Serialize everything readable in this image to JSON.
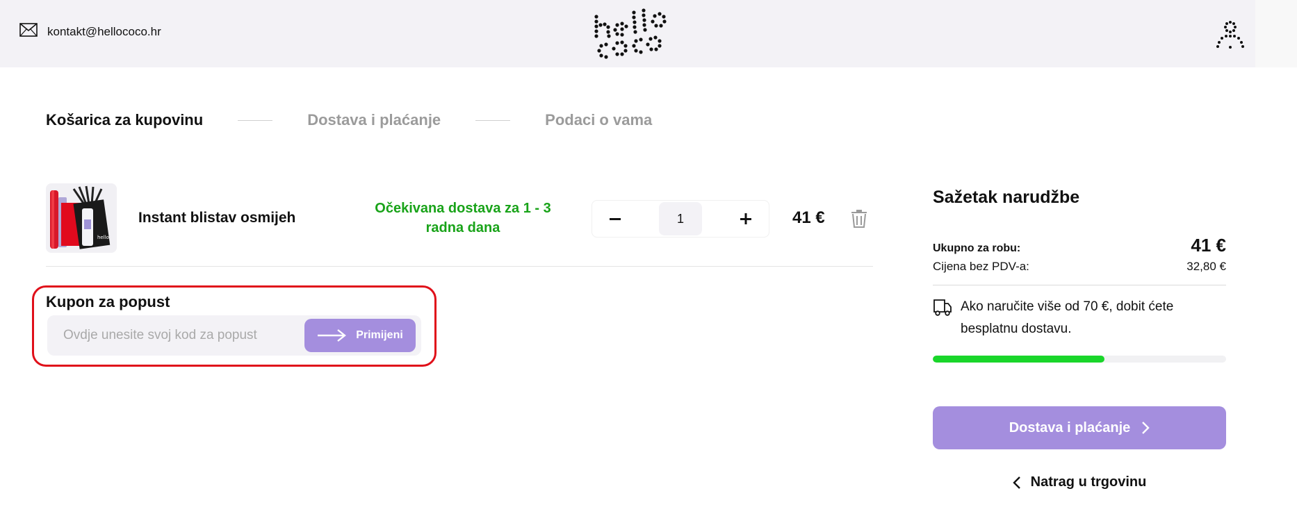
{
  "header": {
    "contact_icon": "envelope-icon",
    "contact_email": "kontakt@hellococo.hr",
    "logo_text": "hello coco",
    "user_icon": "user-icon"
  },
  "steps": [
    {
      "label": "Košarica za kupovinu",
      "active": true
    },
    {
      "label": "Dostava i plaćanje",
      "active": false
    },
    {
      "label": "Podaci o vama",
      "active": false
    }
  ],
  "cart": {
    "items": [
      {
        "name": "Instant blistav osmijeh",
        "delivery_line1": "Očekivana dostava za 1 - 3",
        "delivery_line2": "radna dana",
        "quantity": "1",
        "minus": "−",
        "plus": "+",
        "price": "41 €",
        "delete_icon": "trash-icon"
      }
    ]
  },
  "coupon": {
    "title": "Kupon za popust",
    "placeholder": "Ovdje unesite svoj kod za popust",
    "value": "",
    "apply_label": "Primijeni",
    "apply_icon": "arrow-right-icon"
  },
  "summary": {
    "title": "Sažetak narudžbe",
    "goods_total_label": "Ukupno za robu:",
    "goods_total_value": "41 €",
    "net_label": "Cijena bez PDV-a:",
    "net_value": "32,80 €",
    "free_shipping_icon": "delivery-truck-icon",
    "free_shipping_text": "Ako naručite više od 70 €, dobit ćete besplatnu dostavu.",
    "shipping_progress": 0.586,
    "checkout_label": "Dostava i plaćanje",
    "back_label": "Natrag u trgovinu"
  },
  "colors": {
    "accent": "#a48ede",
    "delivery_green": "#19a319",
    "progress_green": "#19d62a",
    "highlight_red": "#e0101a",
    "header_bg": "#f3f2f6"
  }
}
